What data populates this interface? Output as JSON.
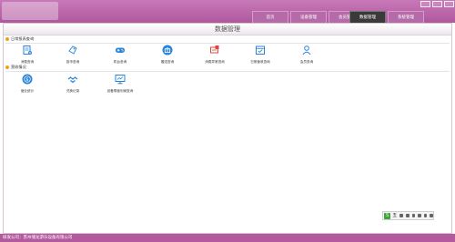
{
  "tabs": [
    {
      "label": "首页",
      "active": false
    },
    {
      "label": "设备管理",
      "active": false
    },
    {
      "label": "会员管理",
      "active": false
    },
    {
      "label": "数据管理",
      "active": true
    },
    {
      "label": "系统管理",
      "active": false
    }
  ],
  "panel": {
    "title": "数据管理"
  },
  "sections": [
    {
      "label": "日常报表查询",
      "items": [
        {
          "label": "消费查询",
          "icon": "receipt-icon"
        },
        {
          "label": "投币查询",
          "icon": "coin-tag-icon"
        },
        {
          "label": "机台查询",
          "icon": "gamepad-icon"
        },
        {
          "label": "赠送查询",
          "icon": "gift-icon"
        },
        {
          "label": "消费异常查询",
          "icon": "alert-device-icon"
        },
        {
          "label": "日常营收查询",
          "icon": "calendar-check-icon"
        },
        {
          "label": "会员查询",
          "icon": "user-icon"
        }
      ]
    },
    {
      "label": "营收情况",
      "items": [
        {
          "label": "营业统计",
          "icon": "dollar-circle-icon"
        },
        {
          "label": "兑换记录",
          "icon": "handshake-icon"
        },
        {
          "label": "设备季度利润查询",
          "icon": "monitor-chart-icon"
        }
      ]
    }
  ],
  "tray": {
    "logo_char": "S",
    "char": "五"
  },
  "footer": {
    "text": "研发公司：苏州储龙游乐设备有限公司"
  },
  "colors": {
    "titlebar": "#b35a9f",
    "icon_blue": "#2a84d8",
    "icon_red": "#e0443a"
  }
}
